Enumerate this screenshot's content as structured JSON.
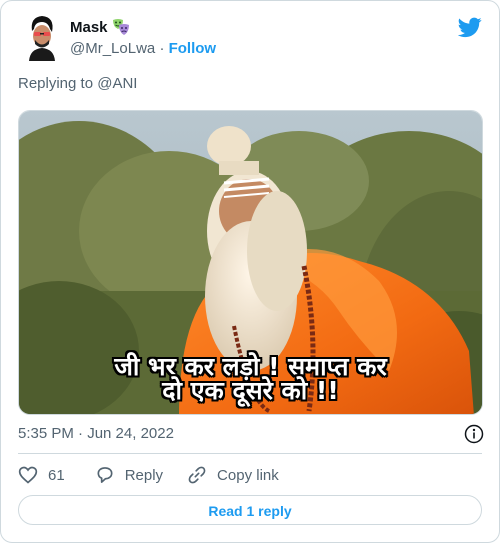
{
  "author": {
    "name": "Mask",
    "handle": "@Mr_LoLwa",
    "separator": "·",
    "follow_label": "Follow"
  },
  "icons": {
    "avatar": "avatar",
    "name_emoji": "masks-emoji-icon",
    "platform": "twitter-bird-icon",
    "info": "info-icon",
    "like": "heart-icon",
    "reply": "reply-bubble-icon",
    "copy": "link-icon"
  },
  "replying_to": "Replying to @ANI",
  "media": {
    "subtitle_line1": "जी भर कर लड़ो ! समाप्त कर",
    "subtitle_line2": "दो एक दूसरे को !!"
  },
  "timestamp": "5:35 PM · Jun 24, 2022",
  "actions": {
    "like_count": "61",
    "reply_label": "Reply",
    "copy_label": "Copy link"
  },
  "read_replies_label": "Read 1 reply",
  "colors": {
    "accent": "#1d9bf0",
    "text": "#0f1419",
    "muted": "#536471",
    "border": "#cfd9de"
  }
}
